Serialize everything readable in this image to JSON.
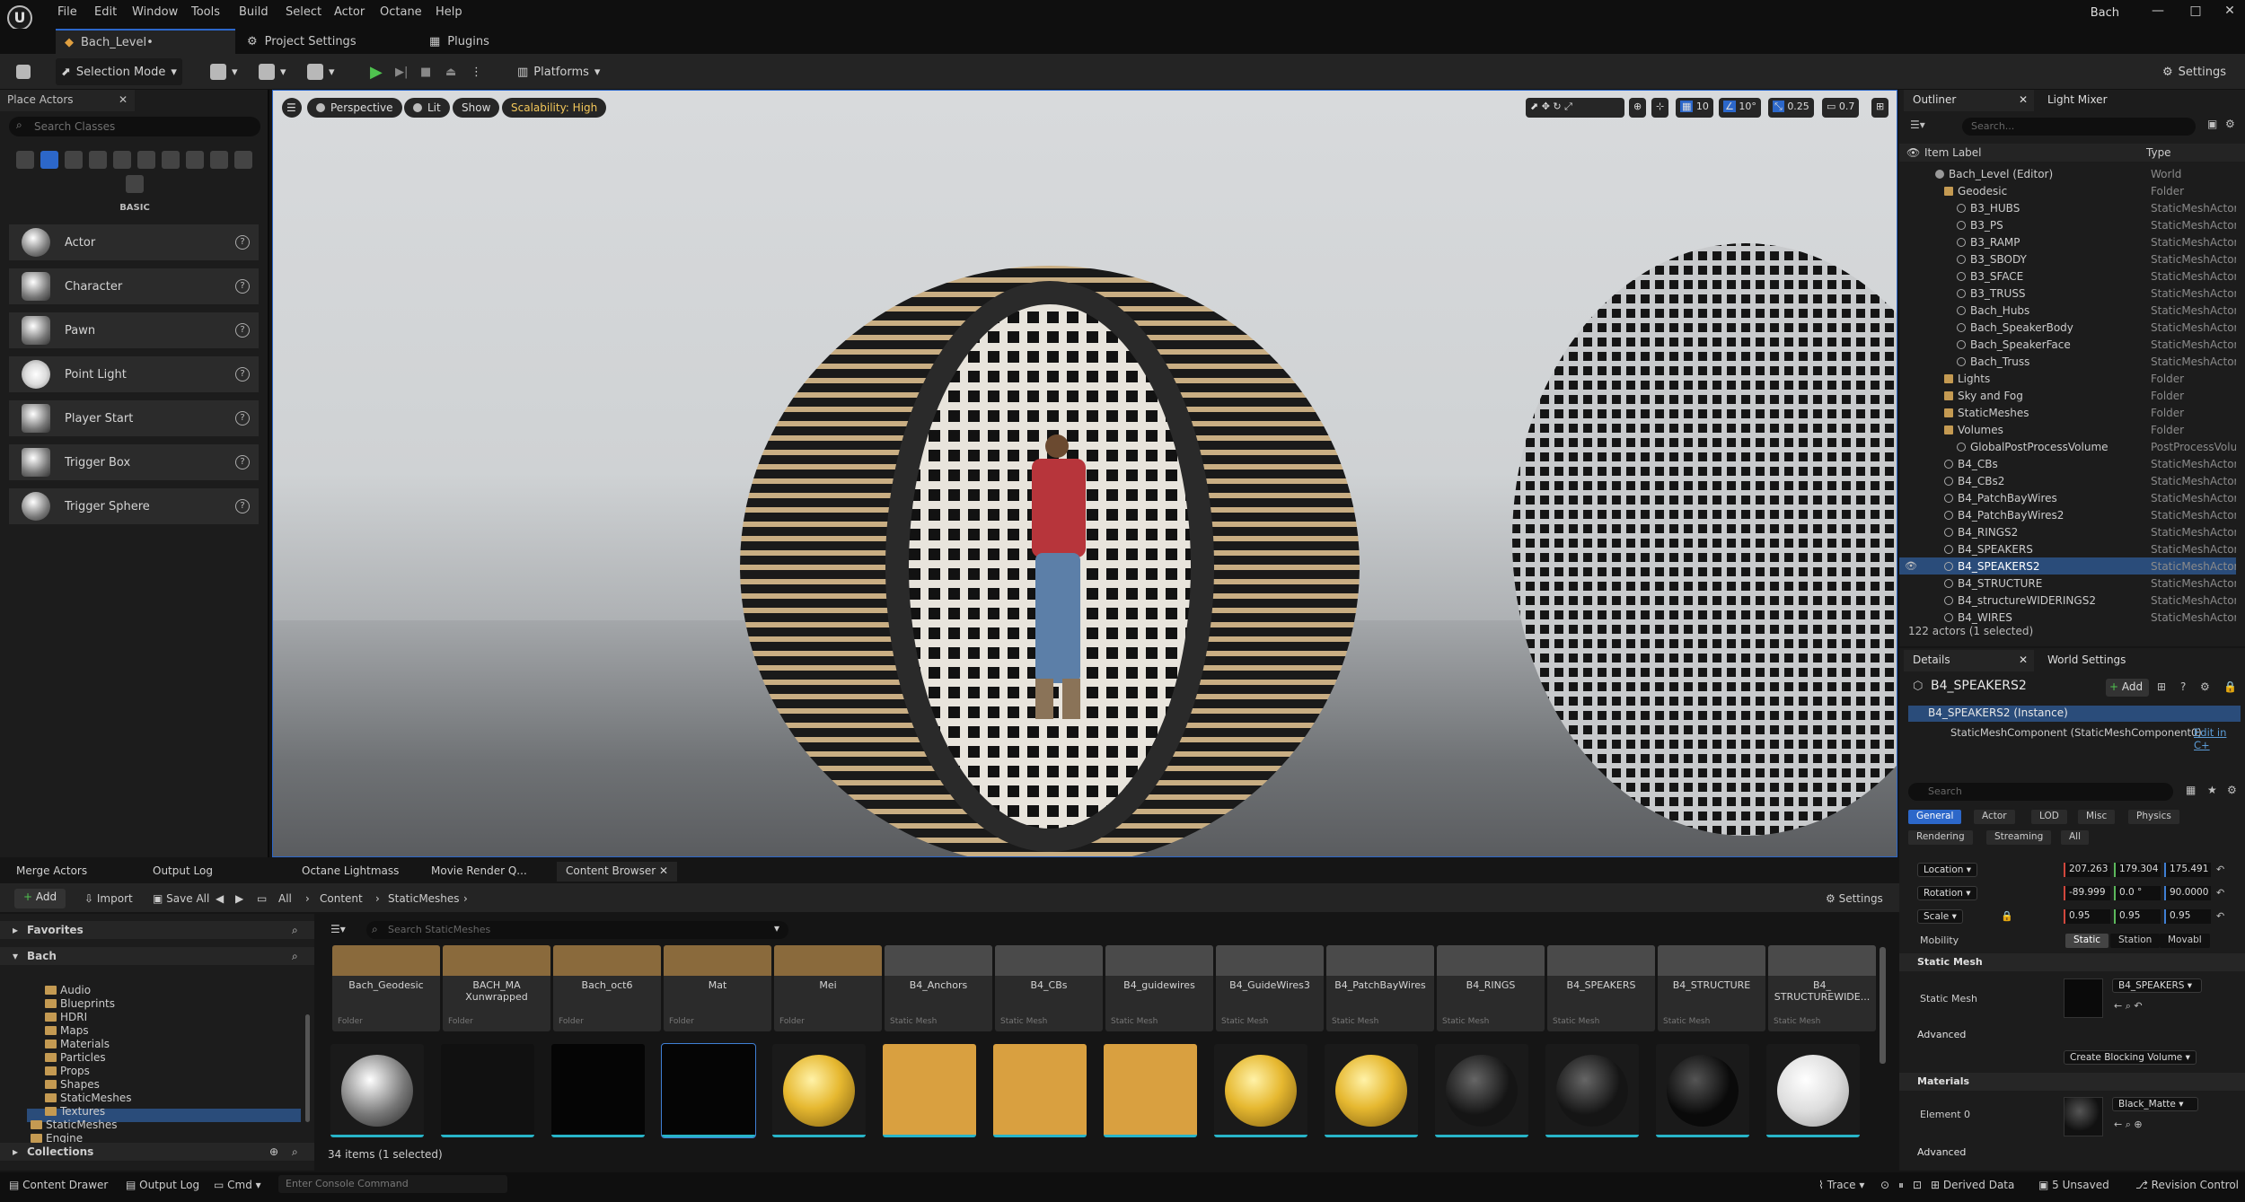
{
  "menu": [
    "File",
    "Edit",
    "Window",
    "Tools",
    "Build",
    "Select",
    "Actor",
    "Octane",
    "Help"
  ],
  "project_name": "Bach",
  "doc_tabs": [
    "Bach_Level•",
    "Project Settings",
    "Plugins"
  ],
  "toolbar": {
    "selection_mode": "Selection Mode",
    "platforms": "Platforms",
    "settings": "Settings"
  },
  "place_actors": {
    "tab": "Place Actors",
    "search_placeholder": "Search Classes",
    "category": "BASIC",
    "items": [
      "Actor",
      "Character",
      "Pawn",
      "Point Light",
      "Player Start",
      "Trigger Box",
      "Trigger Sphere"
    ]
  },
  "viewport": {
    "perspective": "Perspective",
    "lit": "Lit",
    "show": "Show",
    "scalability": "Scalability: High",
    "grid_snap": "10",
    "rot_snap": "10°",
    "scale_snap": "0.25",
    "cam_speed": "0.7"
  },
  "outliner": {
    "tab": "Outliner",
    "tab2": "Light Mixer",
    "search_placeholder": "Search...",
    "col_label": "Item Label",
    "col_type": "Type",
    "rows": [
      {
        "name": "Bach_Level (Editor)",
        "type": "World"
      },
      {
        "name": "Geodesic",
        "type": "Folder"
      },
      {
        "name": "B3_HUBS",
        "type": "StaticMeshActor"
      },
      {
        "name": "B3_PS",
        "type": "StaticMeshActor"
      },
      {
        "name": "B3_RAMP",
        "type": "StaticMeshActor"
      },
      {
        "name": "B3_SBODY",
        "type": "StaticMeshActor"
      },
      {
        "name": "B3_SFACE",
        "type": "StaticMeshActor"
      },
      {
        "name": "B3_TRUSS",
        "type": "StaticMeshActor"
      },
      {
        "name": "Bach_Hubs",
        "type": "StaticMeshActor"
      },
      {
        "name": "Bach_SpeakerBody",
        "type": "StaticMeshActor"
      },
      {
        "name": "Bach_SpeakerFace",
        "type": "StaticMeshActor"
      },
      {
        "name": "Bach_Truss",
        "type": "StaticMeshActor"
      },
      {
        "name": "Lights",
        "type": "Folder"
      },
      {
        "name": "Sky and Fog",
        "type": "Folder"
      },
      {
        "name": "StaticMeshes",
        "type": "Folder"
      },
      {
        "name": "Volumes",
        "type": "Folder"
      },
      {
        "name": "GlobalPostProcessVolume",
        "type": "PostProcessVolume"
      },
      {
        "name": "B4_CBs",
        "type": "StaticMeshActor"
      },
      {
        "name": "B4_CBs2",
        "type": "StaticMeshActor"
      },
      {
        "name": "B4_PatchBayWires",
        "type": "StaticMeshActor"
      },
      {
        "name": "B4_PatchBayWires2",
        "type": "StaticMeshActor"
      },
      {
        "name": "B4_RINGS2",
        "type": "StaticMeshActor"
      },
      {
        "name": "B4_SPEAKERS",
        "type": "StaticMeshActor"
      },
      {
        "name": "B4_SPEAKERS2",
        "type": "StaticMeshActor"
      },
      {
        "name": "B4_STRUCTURE",
        "type": "StaticMeshActor"
      },
      {
        "name": "B4_structureWIDERINGS2",
        "type": "StaticMeshActor"
      },
      {
        "name": "B4_WIRES",
        "type": "StaticMeshActor"
      }
    ],
    "count": "122 actors (1 selected)"
  },
  "details": {
    "tab": "Details",
    "tab2": "World Settings",
    "actor_name": "B4_SPEAKERS2",
    "add": "Add",
    "instance": "B4_SPEAKERS2 (Instance)",
    "component": "StaticMeshComponent (StaticMeshComponent0)",
    "edit_in": "Edit in C+",
    "search_placeholder": "Search",
    "filters": [
      "General",
      "Actor",
      "LOD",
      "Misc",
      "Physics",
      "Rendering",
      "Streaming",
      "All"
    ],
    "location_label": "Location",
    "location": [
      "207.263",
      "179.304",
      "175.491"
    ],
    "rotation_label": "Rotation",
    "rotation": [
      "-89.999",
      "0.0 °",
      "90.0000"
    ],
    "scale_label": "Scale",
    "scale": [
      "0.95",
      "0.95",
      "0.95"
    ],
    "mobility_label": "Mobility",
    "mobility": [
      "Static",
      "Station",
      "Movabl"
    ],
    "section_static_mesh": "Static Mesh",
    "static_mesh_label": "Static Mesh",
    "static_mesh_value": "B4_SPEAKERS",
    "section_advanced": "Advanced",
    "blocking_volume": "Create Blocking Volume",
    "section_materials": "Materials",
    "element0_label": "Element 0",
    "element0_value": "Black_Matte",
    "section_advanced2": "Advanced"
  },
  "bottom_tabs": [
    "Merge Actors",
    "Output Log",
    "Octane Lightmass",
    "Movie Render Q...",
    "Content Browser"
  ],
  "content_browser": {
    "add": "Add",
    "import": "Import",
    "save_all": "Save All",
    "path": [
      "All",
      "Content",
      "StaticMeshes"
    ],
    "settings": "Settings",
    "favorites": "Favorites",
    "root": "Bach",
    "tree": [
      "Audio",
      "Blueprints",
      "HDRI",
      "Maps",
      "Materials",
      "Particles",
      "Props",
      "Shapes",
      "StaticMeshes",
      "Textures",
      "StaticMeshes",
      "Engine"
    ],
    "collections": "Collections",
    "search_placeholder": "Search StaticMeshes",
    "assets": [
      {
        "name": "Bach_Geodesic",
        "type": "Folder"
      },
      {
        "name": "BACH_MA Xunwrapped",
        "type": "Folder"
      },
      {
        "name": "Bach_oct6",
        "type": "Folder"
      },
      {
        "name": "Mat",
        "type": "Folder"
      },
      {
        "name": "Mei",
        "type": "Folder"
      },
      {
        "name": "B4_Anchors",
        "type": "Static Mesh"
      },
      {
        "name": "B4_CBs",
        "type": "Static Mesh"
      },
      {
        "name": "B4_guidewires",
        "type": "Static Mesh"
      },
      {
        "name": "B4_GuideWires3",
        "type": "Static Mesh"
      },
      {
        "name": "B4_PatchBayWires",
        "type": "Static Mesh"
      },
      {
        "name": "B4_RINGS",
        "type": "Static Mesh"
      },
      {
        "name": "B4_SPEAKERS",
        "type": "Static Mesh"
      },
      {
        "name": "B4_STRUCTURE",
        "type": "Static Mesh"
      },
      {
        "name": "B4_ STRUCTUREWIDE...",
        "type": "Static Mesh"
      }
    ],
    "status": "34 items (1 selected)"
  },
  "statusbar": {
    "content_drawer": "Content Drawer",
    "output_log": "Output Log",
    "cmd": "Cmd",
    "console_placeholder": "Enter Console Command",
    "trace": "Trace",
    "derived_data": "Derived Data",
    "unsaved": "5 Unsaved",
    "revision_control": "Revision Control"
  }
}
